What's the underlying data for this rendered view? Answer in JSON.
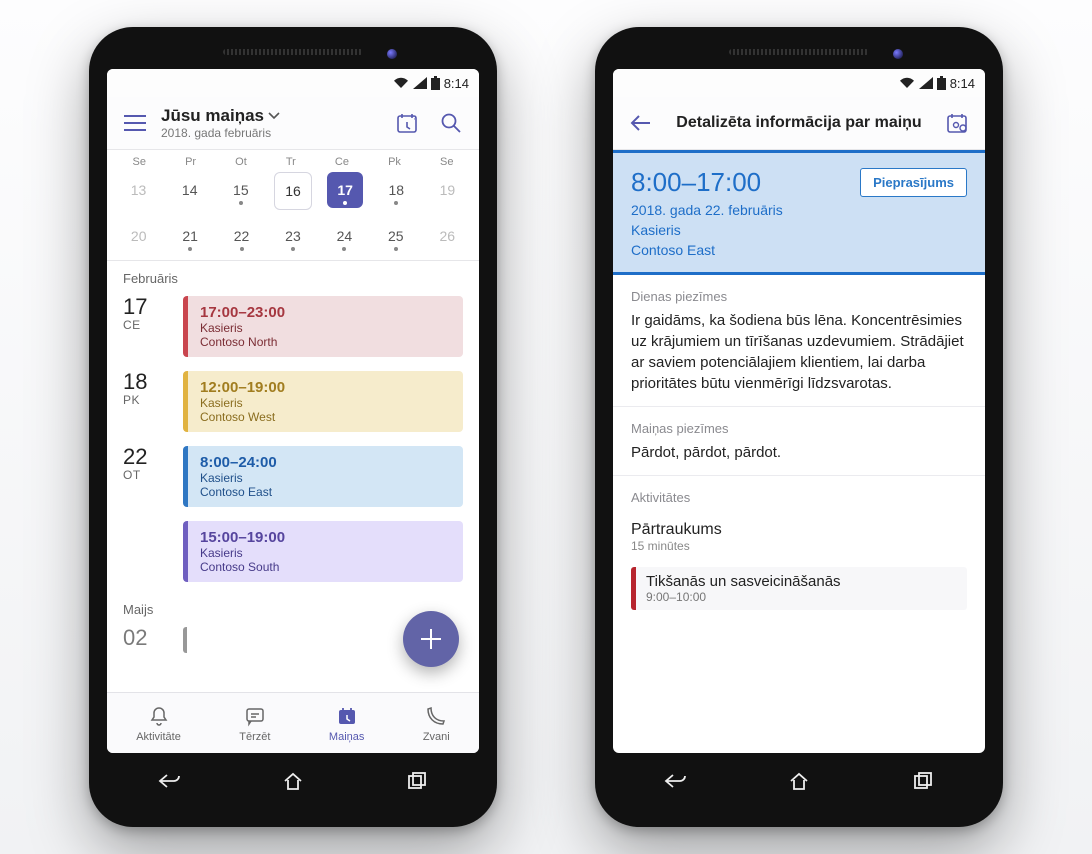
{
  "status": {
    "time": "8:14"
  },
  "left": {
    "header": {
      "title": "Jūsu maiņas",
      "subtitle": "2018. gada februāris"
    },
    "calendar": {
      "days_of_week": [
        "Se",
        "Pr",
        "Ot",
        "Tr",
        "Ce",
        "Pk",
        "Se"
      ],
      "row1": [
        "13",
        "14",
        "15",
        "16",
        "17",
        "18",
        "19"
      ],
      "row2": [
        "20",
        "21",
        "22",
        "23",
        "24",
        "25",
        "26"
      ]
    },
    "month_label": "Februāris",
    "next_month_label": "Maijs",
    "cutoff_date": "02",
    "entries": [
      {
        "date_num": "17",
        "dow": "CE",
        "time": "17:00–23:00",
        "role": "Kasieris",
        "loc": "Contoso North",
        "color": "red"
      },
      {
        "date_num": "18",
        "dow": "PK",
        "time": "12:00–19:00",
        "role": "Kasieris",
        "loc": "Contoso West",
        "color": "yellow"
      },
      {
        "date_num": "22",
        "dow": "OT",
        "time": "8:00–24:00",
        "role": "Kasieris",
        "loc": "Contoso East",
        "color": "blue"
      },
      {
        "date_num": "",
        "dow": "",
        "time": "15:00–19:00",
        "role": "Kasieris",
        "loc": "Contoso South",
        "color": "purple"
      }
    ],
    "tabs": [
      {
        "id": "activity",
        "label": "Aktivitāte"
      },
      {
        "id": "chat",
        "label": "Tērzēt"
      },
      {
        "id": "shifts",
        "label": "Maiņas"
      },
      {
        "id": "calls",
        "label": "Zvani"
      }
    ]
  },
  "right": {
    "header_title": "Detalizēta informācija par maiņu",
    "hero": {
      "time": "8:00–17:00",
      "request_label": "Pieprasījums",
      "date_line": "2018. gada 22. februāris",
      "role": "Kasieris",
      "location": "Contoso East"
    },
    "day_notes_label": "Dienas piezīmes",
    "day_notes_body": "Ir gaidāms, ka šodiena būs lēna. Koncentrēsimies uz krājumiem un tīrīšanas uzdevumiem. Strādājiet ar saviem potenciālajiem klientiem, lai darba prioritātes būtu vienmērīgi līdzsvarotas.",
    "shift_notes_label": "Maiņas piezīmes",
    "shift_notes_body": "Pārdot, pārdot, pārdot.",
    "activities_label": "Aktivitātes",
    "break_title": "Pārtraukums",
    "break_sub": "15 minūtes",
    "act_card_title": "Tikšanās un sasveicināšanās",
    "act_card_time": "9:00–10:00"
  }
}
